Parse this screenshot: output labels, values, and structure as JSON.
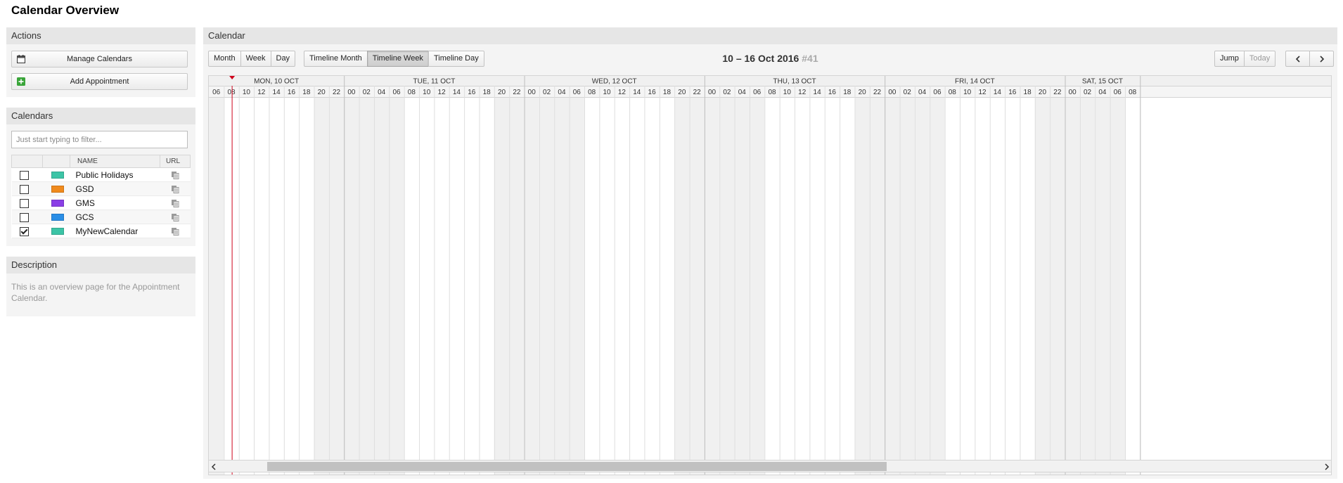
{
  "page": {
    "title": "Calendar Overview"
  },
  "actions": {
    "header": "Actions",
    "manage_calendars": "Manage Calendars",
    "add_appointment": "Add Appointment"
  },
  "calendars": {
    "header": "Calendars",
    "filter_placeholder": "Just start typing to filter...",
    "col_name": "NAME",
    "col_url": "URL",
    "items": [
      {
        "name": "Public Holidays",
        "color": "#3cc4a6",
        "checked": false
      },
      {
        "name": "GSD",
        "color": "#f08a1d",
        "checked": false
      },
      {
        "name": "GMS",
        "color": "#8a3ee6",
        "checked": false
      },
      {
        "name": "GCS",
        "color": "#2a8ee6",
        "checked": false
      },
      {
        "name": "MyNewCalendar",
        "color": "#3cc4a6",
        "checked": true
      }
    ]
  },
  "description": {
    "header": "Description",
    "text": "This is an overview page for the Appointment Calendar."
  },
  "main": {
    "header": "Calendar",
    "view_buttons": [
      "Month",
      "Week",
      "Day"
    ],
    "timeline_buttons": [
      "Timeline Month",
      "Timeline Week",
      "Timeline Day"
    ],
    "active_timeline": "Timeline Week",
    "range": "10 – 16 Oct 2016",
    "week": "#41",
    "jump": "Jump",
    "today": "Today",
    "prev_icon": "chevron-left-icon",
    "next_icon": "chevron-right-icon",
    "days": [
      {
        "label": "MON, 10 OCT",
        "hours": [
          "06",
          "08",
          "10",
          "12",
          "14",
          "16",
          "18",
          "20",
          "22"
        ]
      },
      {
        "label": "TUE, 11 OCT",
        "hours": [
          "00",
          "02",
          "04",
          "06",
          "08",
          "10",
          "12",
          "14",
          "16",
          "18",
          "20",
          "22"
        ]
      },
      {
        "label": "WED, 12 OCT",
        "hours": [
          "00",
          "02",
          "04",
          "06",
          "08",
          "10",
          "12",
          "14",
          "16",
          "18",
          "20",
          "22"
        ]
      },
      {
        "label": "THU, 13 OCT",
        "hours": [
          "00",
          "02",
          "04",
          "06",
          "08",
          "10",
          "12",
          "14",
          "16",
          "18",
          "20",
          "22"
        ]
      },
      {
        "label": "FRI, 14 OCT",
        "hours": [
          "00",
          "02",
          "04",
          "06",
          "08",
          "10",
          "12",
          "14",
          "16",
          "18",
          "20",
          "22"
        ]
      },
      {
        "label": "SAT, 15 OCT",
        "hours": [
          "00",
          "02",
          "04",
          "06",
          "08"
        ]
      }
    ],
    "now_hour": 9.1,
    "scroll_left_icon": "caret-left-icon",
    "scroll_right_icon": "caret-right-icon",
    "colors": {
      "weekend": "#f0f0f0",
      "now_line": "#d0021b"
    }
  }
}
